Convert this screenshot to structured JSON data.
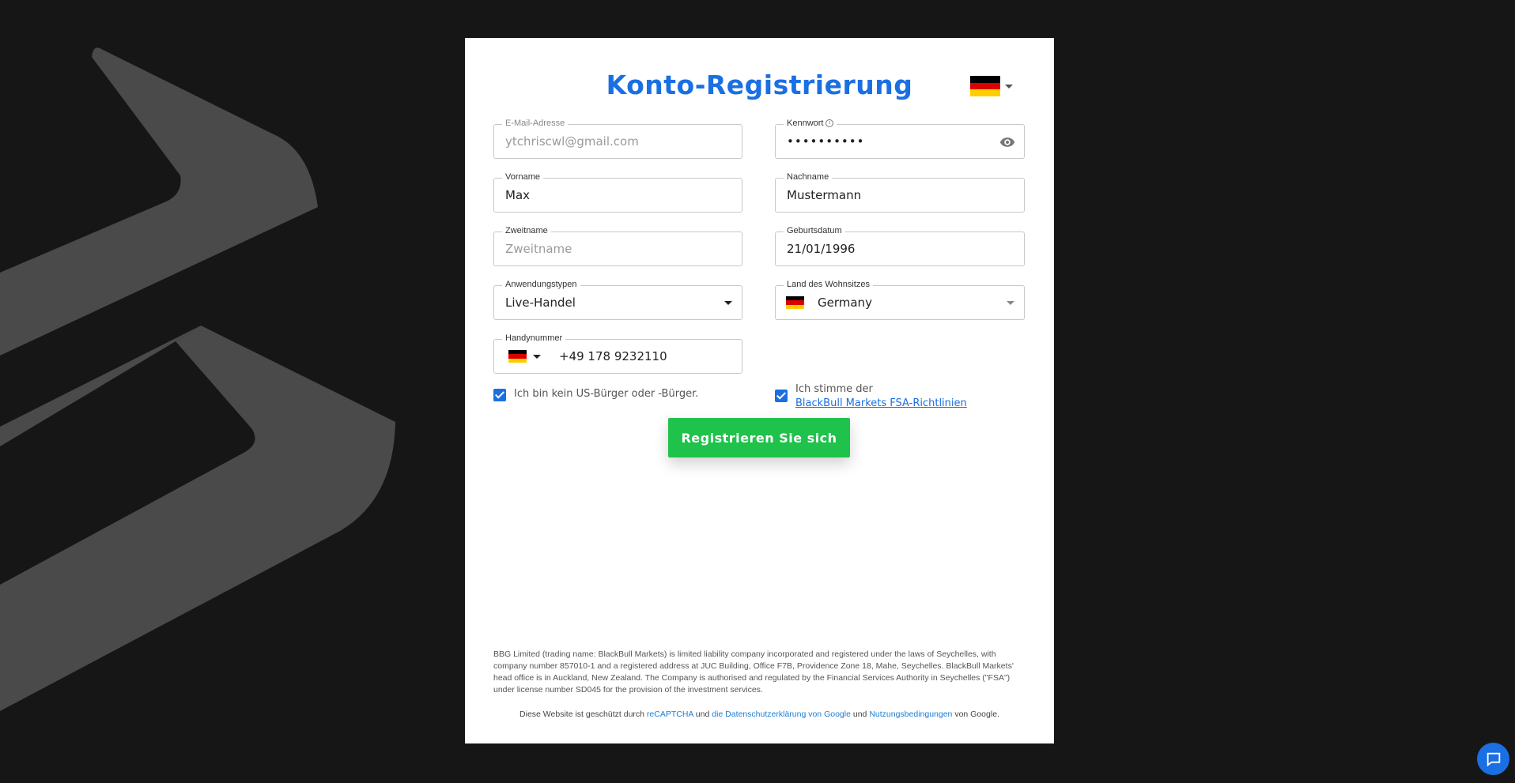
{
  "form": {
    "title": "Konto-Registrierung",
    "language_flag": "de-flag",
    "email": {
      "label": "E-Mail-Adresse",
      "placeholder": "ytchriscwl@gmail.com",
      "value": ""
    },
    "password": {
      "label": "Kennwort",
      "value": "••••••••••"
    },
    "first_name": {
      "label": "Vorname",
      "value": "Max"
    },
    "last_name": {
      "label": "Nachname",
      "value": "Mustermann"
    },
    "middle_name": {
      "label": "Zweitname",
      "placeholder": "Zweitname",
      "value": ""
    },
    "birth_date": {
      "label": "Geburtsdatum",
      "value": "21/01/1996"
    },
    "application_type": {
      "label": "Anwendungstypen",
      "value": "Live-Handel"
    },
    "country": {
      "label": "Land des Wohnsitzes",
      "value": "Germany"
    },
    "phone": {
      "label": "Handynummer",
      "value": "+49 178 9232110"
    },
    "us_citizen_check": {
      "label": "Ich bin kein US-Bürger oder -Bürger.",
      "checked": true
    },
    "fsa_check": {
      "label": "Ich stimme der",
      "link": "BlackBull Markets FSA-Richtlinien",
      "checked": true
    },
    "submit_label": "Registrieren Sie sich"
  },
  "footer": {
    "legal": "BBG Limited (trading name: BlackBull Markets) is limited liability company incorporated and registered under the laws of Seychelles, with company number 857010-1 and a registered address at JUC Building, Office F7B, Providence Zone 18, Mahe, Seychelles. BlackBull Markets' head office is in Auckland, New Zealand. The Company is authorised and regulated by the Financial Services Authority in Seychelles (\"FSA\") under license number SD045 for the provision of the investment services.",
    "recaptcha_prefix": "Diese Website ist geschützt durch",
    "recaptcha_link": "reCAPTCHA",
    "and_1": "und",
    "privacy_link": "die Datenschutzerklärung von Google",
    "and_2": "und",
    "terms_link": "Nutzungsbedingungen",
    "suffix": "von Google."
  },
  "colors": {
    "accent": "#1a6fe3",
    "submit": "#1fc24a",
    "background": "#161616",
    "logo": "#4a4a4a"
  }
}
